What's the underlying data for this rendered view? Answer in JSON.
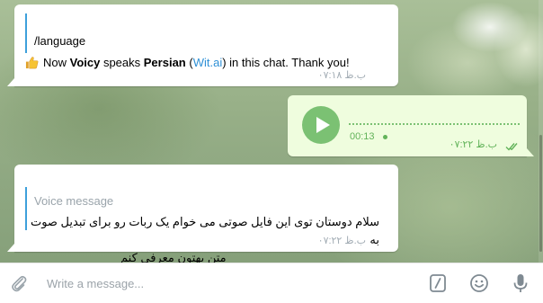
{
  "messages": {
    "m1": {
      "command": "/language",
      "text_pre": "Now ",
      "bold1": "Voicy",
      "text_mid": " speaks ",
      "bold2": "Persian",
      "text_open": " (",
      "link": "Wit.ai",
      "text_post": ") in this chat. Thank you!",
      "time": "ب.ظ ۰۷:۱۸"
    },
    "m2": {
      "duration": "00:13",
      "time": "ب.ظ ۰۷:۲۲"
    },
    "m3": {
      "reply_label": "Voice message",
      "line1": "سلام دوستان توی این فایل صوتی می خوام یک ربات رو برای تبدیل صوت به",
      "line2": "متن بهتون معرفی کنم",
      "time": "ب.ظ ۰۷:۲۲"
    }
  },
  "composer": {
    "placeholder": "Write a message..."
  },
  "icons": {
    "attach": "paperclip-icon",
    "commands": "slash-command-icon",
    "emoji": "smile-icon",
    "mic": "microphone-icon",
    "play": "play-icon",
    "read": "double-check-icon",
    "thumbs": "thumbs-up-emoji"
  },
  "colors": {
    "accent": "#3ea0db",
    "outgoing_bubble": "#effdde",
    "outgoing_text": "#62b35a",
    "play_button": "#7bc173"
  }
}
